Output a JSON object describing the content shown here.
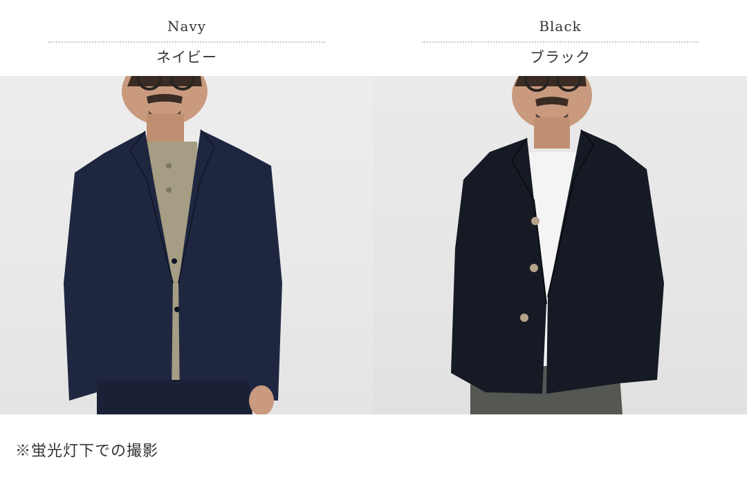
{
  "panels": [
    {
      "color_en": "Navy",
      "color_ja": "ネイビー",
      "jacket_color": "#1f2740",
      "inner_color": "#a59d84"
    },
    {
      "color_en": "Black",
      "color_ja": "ブラック",
      "jacket_color": "#161a24",
      "inner_color": "#f4f4f4"
    }
  ],
  "note": "※蛍光灯下での撮影"
}
